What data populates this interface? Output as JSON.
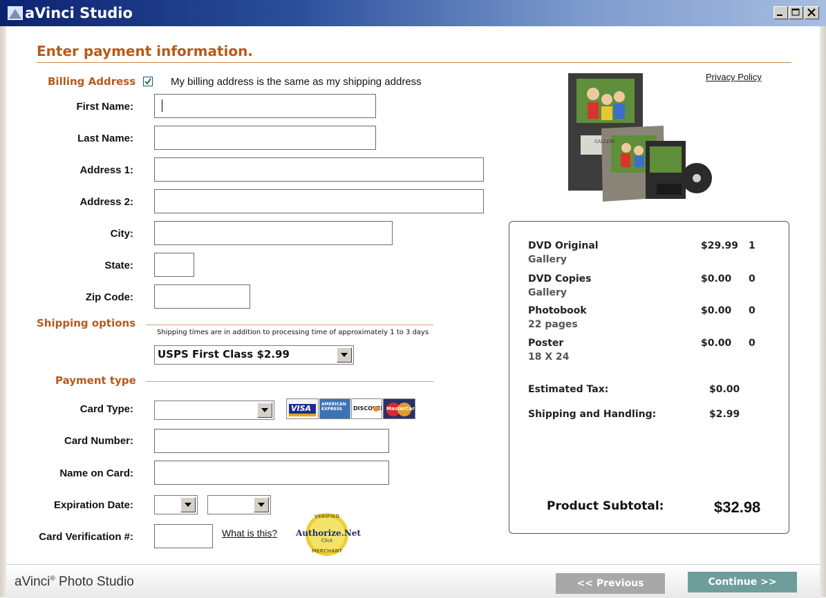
{
  "window": {
    "title": "aVinci Studio"
  },
  "page": {
    "heading": "Enter payment information",
    "heading_dot": "."
  },
  "links": {
    "privacy": "Privacy Policy",
    "what_is_this": "What is this?"
  },
  "billing": {
    "section_label": "Billing Address",
    "same_as_shipping_checked": true,
    "same_as_shipping_label": "My billing address is the same as my shipping address",
    "fields": {
      "first_name": {
        "label": "First Name:",
        "value": ""
      },
      "last_name": {
        "label": "Last Name:",
        "value": ""
      },
      "address1": {
        "label": "Address 1:",
        "value": ""
      },
      "address2": {
        "label": "Address 2:",
        "value": ""
      },
      "city": {
        "label": "City:",
        "value": ""
      },
      "state": {
        "label": "State:",
        "value": ""
      },
      "zip": {
        "label": "Zip Code:",
        "value": ""
      }
    }
  },
  "shipping": {
    "section_label": "Shipping options",
    "note": "Shipping times are in addition to processing time of approximately 1 to 3 days",
    "selected": "USPS First Class $2.99"
  },
  "payment": {
    "section_label": "Payment type",
    "card_type_label": "Card Type:",
    "card_type_value": "",
    "card_number_label": "Card Number:",
    "name_on_card_label": "Name on Card:",
    "expiration_label": "Expiration Date:",
    "exp_month": "",
    "exp_year": "",
    "cvv_label": "Card Verification #:",
    "card_logos": {
      "visa": "VISA",
      "amex": "AMERICAN EXPRESS",
      "discover": "DISCOVER",
      "mastercard": "MasterCard"
    },
    "badge": {
      "top": "VERIFIED",
      "main": "Authorize.Net",
      "sub": "Click",
      "bottom": "MERCHANT"
    }
  },
  "summary": {
    "items": [
      {
        "name": "DVD Original",
        "sub": "Gallery",
        "price": "$29.99",
        "qty": "1"
      },
      {
        "name": "DVD Copies",
        "sub": "Gallery",
        "price": "$0.00",
        "qty": "0"
      },
      {
        "name": "Photobook",
        "sub": "22 pages",
        "price": "$0.00",
        "qty": "0"
      },
      {
        "name": "Poster",
        "sub": "18 X 24",
        "price": "$0.00",
        "qty": "0"
      }
    ],
    "tax_label": "Estimated Tax:",
    "tax_value": "$0.00",
    "shipping_label": "Shipping and Handling:",
    "shipping_value": "$2.99",
    "subtotal_label": "Product Subtotal:",
    "subtotal_value": "$32.98"
  },
  "product_image": {
    "gallery_text": "GALLERY"
  },
  "footer": {
    "brand": "aVinci",
    "brand_mark": "®",
    "brand_suffix": " Photo Studio",
    "prev_label": "<< Previous",
    "next_label": "Continue >>"
  }
}
